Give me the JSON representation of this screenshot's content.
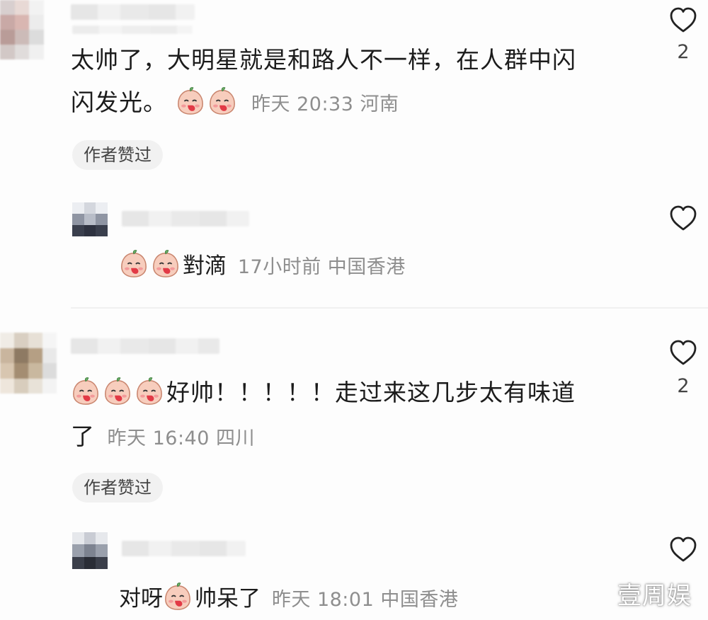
{
  "comments": [
    {
      "text_line1": "太帅了，大明星就是和路人不一样，在人群中闪",
      "text_line2": "闪发光。",
      "time": "昨天 20:33 河南",
      "tag": "作者赞过",
      "likes": "2",
      "reply": {
        "text": "對滴",
        "time": "17小时前 中国香港"
      }
    },
    {
      "text_line1": "好帅！！！！！走过来这几步太有味道",
      "text_line2": "了",
      "time": "昨天 16:40 四川",
      "tag": "作者赞过",
      "likes": "2",
      "reply": {
        "text_before": "对呀",
        "text_after": "帅呆了",
        "time": "昨天 18:01 中国香港"
      }
    }
  ],
  "watermark": "壹周娱",
  "icons": {
    "like": "heart-outline-icon",
    "emoji": "peach-blush-emoji-icon"
  },
  "colors": {
    "meta": "#8e8e8e",
    "tag_bg": "#f1f1f1",
    "emoji_skin": "#f6c9b8",
    "emoji_blush": "#e6404a"
  }
}
